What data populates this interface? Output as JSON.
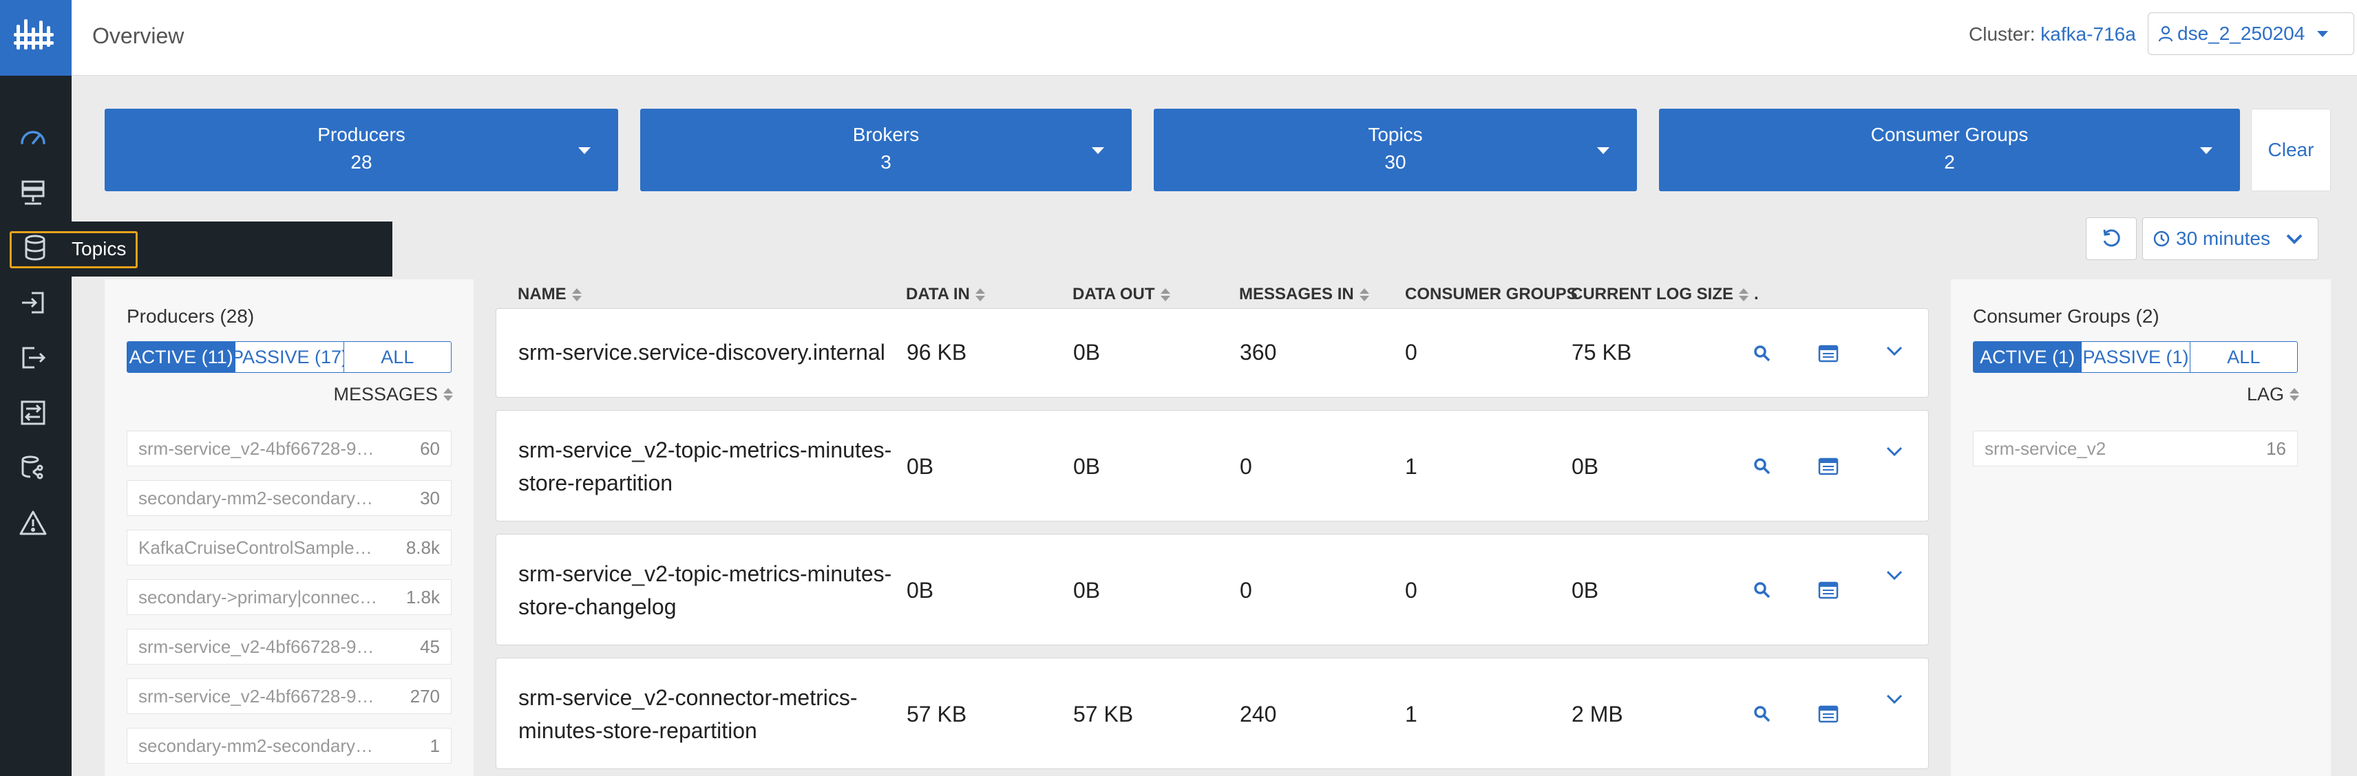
{
  "header": {
    "title": "Overview",
    "cluster_label": "Cluster:",
    "cluster_name": "kafka-716a",
    "user": "dse_2_250204"
  },
  "nav": {
    "items": [
      "dashboard-icon",
      "brokers-icon",
      "topics-icon",
      "producers-icon",
      "consumers-icon",
      "replication-icon",
      "data-explorer-icon",
      "alerts-icon"
    ],
    "flyout_label": "Topics"
  },
  "filters": [
    {
      "label": "Producers",
      "count": "28"
    },
    {
      "label": "Brokers",
      "count": "3"
    },
    {
      "label": "Topics",
      "count": "30"
    },
    {
      "label": "Consumer Groups",
      "count": "2"
    }
  ],
  "clear_label": "Clear",
  "time_range": "30 minutes",
  "producers_panel": {
    "title": "Producers (28)",
    "tabs": [
      "ACTIVE (11)",
      "PASSIVE (17)",
      "ALL"
    ],
    "sort_label": "MESSAGES",
    "items": [
      {
        "name": "srm-service_v2-4bf66728-9…",
        "value": "60"
      },
      {
        "name": "secondary-mm2-secondary…",
        "value": "30"
      },
      {
        "name": "KafkaCruiseControlSample…",
        "value": "8.8k"
      },
      {
        "name": "secondary->primary|connec…",
        "value": "1.8k"
      },
      {
        "name": "srm-service_v2-4bf66728-9…",
        "value": "45"
      },
      {
        "name": "srm-service_v2-4bf66728-9…",
        "value": "270"
      },
      {
        "name": "secondary-mm2-secondary…",
        "value": "1"
      }
    ]
  },
  "consumers_panel": {
    "title": "Consumer Groups (2)",
    "tabs": [
      "ACTIVE (1)",
      "PASSIVE (1)",
      "ALL"
    ],
    "sort_label": "LAG",
    "items": [
      {
        "name": "srm-service_v2",
        "value": "16"
      }
    ]
  },
  "topics_table": {
    "columns": [
      "NAME",
      "DATA IN",
      "DATA OUT",
      "MESSAGES IN",
      "CONSUMER GROUPS",
      "CURRENT LOG SIZE"
    ],
    "rows": [
      {
        "name_line1": "srm-service.service-discovery.internal",
        "name_line2": "",
        "data_in": "96 KB",
        "data_out": "0B",
        "messages_in": "360",
        "consumer_groups": "0",
        "log_size": "75 KB"
      },
      {
        "name_line1": "srm-service_v2-topic-metrics-minutes-",
        "name_line2": "store-repartition",
        "data_in": "0B",
        "data_out": "0B",
        "messages_in": "0",
        "consumer_groups": "1",
        "log_size": "0B"
      },
      {
        "name_line1": "srm-service_v2-topic-metrics-minutes-",
        "name_line2": "store-changelog",
        "data_in": "0B",
        "data_out": "0B",
        "messages_in": "0",
        "consumer_groups": "0",
        "log_size": "0B"
      },
      {
        "name_line1": "srm-service_v2-connector-metrics-",
        "name_line2": "minutes-store-repartition",
        "data_in": "57 KB",
        "data_out": "57 KB",
        "messages_in": "240",
        "consumer_groups": "1",
        "log_size": "2 MB"
      }
    ]
  },
  "colors": {
    "accent": "#2d6fc5",
    "nav_bg": "#1c2329",
    "highlight": "#e6a21b"
  }
}
